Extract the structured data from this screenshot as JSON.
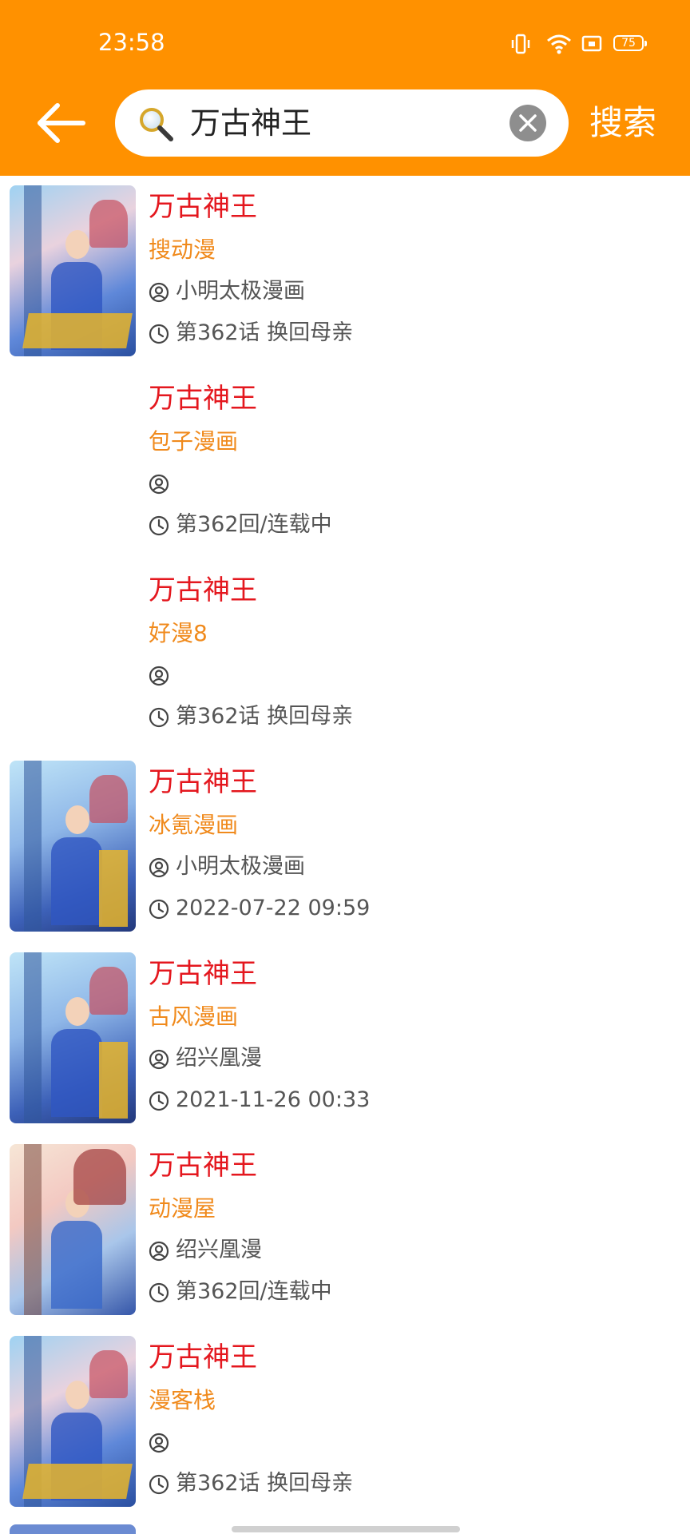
{
  "status_bar": {
    "time": "23:58",
    "battery_level": "75",
    "icons": [
      "vibrate-icon",
      "wifi-icon",
      "screen-cast-icon",
      "battery-icon"
    ]
  },
  "search": {
    "query": "万古神王",
    "button_label": "搜索"
  },
  "theme": {
    "header_color": "#FF9100",
    "title_color": "#E4171E",
    "source_color": "#F08A1C",
    "meta_color": "#555555"
  },
  "results": [
    {
      "title": "万古神王",
      "source": "搜动漫",
      "author": "小明太极漫画",
      "update": "第362话 换回母亲",
      "has_cover": true
    },
    {
      "title": "万古神王",
      "source": "包子漫画",
      "author": "",
      "update": "第362回/连载中",
      "has_cover": false
    },
    {
      "title": "万古神王",
      "source": "好漫8",
      "author": "",
      "update": "第362话 换回母亲",
      "has_cover": false
    },
    {
      "title": "万古神王",
      "source": "冰氪漫画",
      "author": "小明太极漫画",
      "update": "2022-07-22 09:59",
      "has_cover": true
    },
    {
      "title": "万古神王",
      "source": "古风漫画",
      "author": "绍兴凰漫",
      "update": "2021-11-26 00:33",
      "has_cover": true
    },
    {
      "title": "万古神王",
      "source": "动漫屋",
      "author": "绍兴凰漫",
      "update": "第362回/连载中",
      "has_cover": true
    },
    {
      "title": "万古神王",
      "source": "漫客栈",
      "author": "",
      "update": "第362话 换回母亲",
      "has_cover": true
    }
  ]
}
